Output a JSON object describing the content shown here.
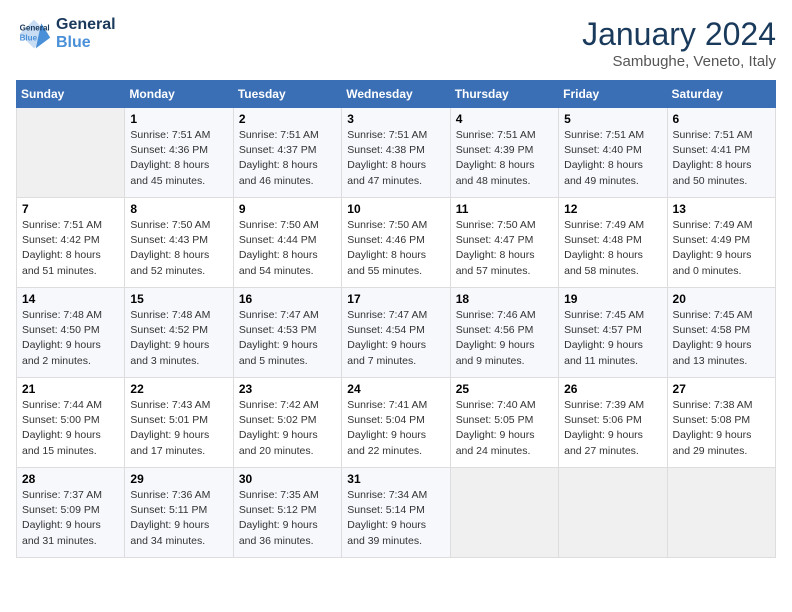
{
  "header": {
    "logo_line1": "General",
    "logo_line2": "Blue",
    "month": "January 2024",
    "location": "Sambughe, Veneto, Italy"
  },
  "days_of_week": [
    "Sunday",
    "Monday",
    "Tuesday",
    "Wednesday",
    "Thursday",
    "Friday",
    "Saturday"
  ],
  "weeks": [
    [
      {
        "day": "",
        "info": ""
      },
      {
        "day": "1",
        "info": "Sunrise: 7:51 AM\nSunset: 4:36 PM\nDaylight: 8 hours\nand 45 minutes."
      },
      {
        "day": "2",
        "info": "Sunrise: 7:51 AM\nSunset: 4:37 PM\nDaylight: 8 hours\nand 46 minutes."
      },
      {
        "day": "3",
        "info": "Sunrise: 7:51 AM\nSunset: 4:38 PM\nDaylight: 8 hours\nand 47 minutes."
      },
      {
        "day": "4",
        "info": "Sunrise: 7:51 AM\nSunset: 4:39 PM\nDaylight: 8 hours\nand 48 minutes."
      },
      {
        "day": "5",
        "info": "Sunrise: 7:51 AM\nSunset: 4:40 PM\nDaylight: 8 hours\nand 49 minutes."
      },
      {
        "day": "6",
        "info": "Sunrise: 7:51 AM\nSunset: 4:41 PM\nDaylight: 8 hours\nand 50 minutes."
      }
    ],
    [
      {
        "day": "7",
        "info": "Sunrise: 7:51 AM\nSunset: 4:42 PM\nDaylight: 8 hours\nand 51 minutes."
      },
      {
        "day": "8",
        "info": "Sunrise: 7:50 AM\nSunset: 4:43 PM\nDaylight: 8 hours\nand 52 minutes."
      },
      {
        "day": "9",
        "info": "Sunrise: 7:50 AM\nSunset: 4:44 PM\nDaylight: 8 hours\nand 54 minutes."
      },
      {
        "day": "10",
        "info": "Sunrise: 7:50 AM\nSunset: 4:46 PM\nDaylight: 8 hours\nand 55 minutes."
      },
      {
        "day": "11",
        "info": "Sunrise: 7:50 AM\nSunset: 4:47 PM\nDaylight: 8 hours\nand 57 minutes."
      },
      {
        "day": "12",
        "info": "Sunrise: 7:49 AM\nSunset: 4:48 PM\nDaylight: 8 hours\nand 58 minutes."
      },
      {
        "day": "13",
        "info": "Sunrise: 7:49 AM\nSunset: 4:49 PM\nDaylight: 9 hours\nand 0 minutes."
      }
    ],
    [
      {
        "day": "14",
        "info": "Sunrise: 7:48 AM\nSunset: 4:50 PM\nDaylight: 9 hours\nand 2 minutes."
      },
      {
        "day": "15",
        "info": "Sunrise: 7:48 AM\nSunset: 4:52 PM\nDaylight: 9 hours\nand 3 minutes."
      },
      {
        "day": "16",
        "info": "Sunrise: 7:47 AM\nSunset: 4:53 PM\nDaylight: 9 hours\nand 5 minutes."
      },
      {
        "day": "17",
        "info": "Sunrise: 7:47 AM\nSunset: 4:54 PM\nDaylight: 9 hours\nand 7 minutes."
      },
      {
        "day": "18",
        "info": "Sunrise: 7:46 AM\nSunset: 4:56 PM\nDaylight: 9 hours\nand 9 minutes."
      },
      {
        "day": "19",
        "info": "Sunrise: 7:45 AM\nSunset: 4:57 PM\nDaylight: 9 hours\nand 11 minutes."
      },
      {
        "day": "20",
        "info": "Sunrise: 7:45 AM\nSunset: 4:58 PM\nDaylight: 9 hours\nand 13 minutes."
      }
    ],
    [
      {
        "day": "21",
        "info": "Sunrise: 7:44 AM\nSunset: 5:00 PM\nDaylight: 9 hours\nand 15 minutes."
      },
      {
        "day": "22",
        "info": "Sunrise: 7:43 AM\nSunset: 5:01 PM\nDaylight: 9 hours\nand 17 minutes."
      },
      {
        "day": "23",
        "info": "Sunrise: 7:42 AM\nSunset: 5:02 PM\nDaylight: 9 hours\nand 20 minutes."
      },
      {
        "day": "24",
        "info": "Sunrise: 7:41 AM\nSunset: 5:04 PM\nDaylight: 9 hours\nand 22 minutes."
      },
      {
        "day": "25",
        "info": "Sunrise: 7:40 AM\nSunset: 5:05 PM\nDaylight: 9 hours\nand 24 minutes."
      },
      {
        "day": "26",
        "info": "Sunrise: 7:39 AM\nSunset: 5:06 PM\nDaylight: 9 hours\nand 27 minutes."
      },
      {
        "day": "27",
        "info": "Sunrise: 7:38 AM\nSunset: 5:08 PM\nDaylight: 9 hours\nand 29 minutes."
      }
    ],
    [
      {
        "day": "28",
        "info": "Sunrise: 7:37 AM\nSunset: 5:09 PM\nDaylight: 9 hours\nand 31 minutes."
      },
      {
        "day": "29",
        "info": "Sunrise: 7:36 AM\nSunset: 5:11 PM\nDaylight: 9 hours\nand 34 minutes."
      },
      {
        "day": "30",
        "info": "Sunrise: 7:35 AM\nSunset: 5:12 PM\nDaylight: 9 hours\nand 36 minutes."
      },
      {
        "day": "31",
        "info": "Sunrise: 7:34 AM\nSunset: 5:14 PM\nDaylight: 9 hours\nand 39 minutes."
      },
      {
        "day": "",
        "info": ""
      },
      {
        "day": "",
        "info": ""
      },
      {
        "day": "",
        "info": ""
      }
    ]
  ]
}
